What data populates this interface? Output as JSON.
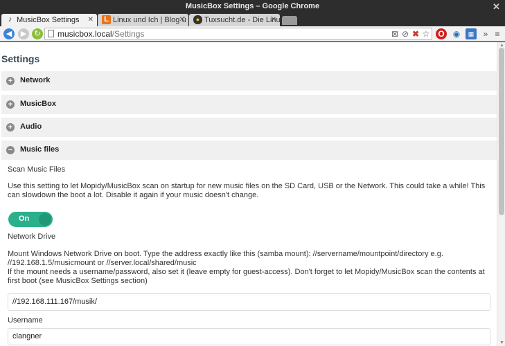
{
  "window": {
    "title": "MusicBox Settings – Google Chrome"
  },
  "tabs": [
    {
      "label": "MusicBox Settings",
      "favicon": "music-note-icon"
    },
    {
      "label": "Linux und Ich | Blog ü",
      "favicon": "letter-l-icon"
    },
    {
      "label": "Tuxsucht.de - Die Linu",
      "favicon": "tux-icon"
    }
  ],
  "toolbar": {
    "url_host": "musicbox.local",
    "url_path": "/Settings"
  },
  "page": {
    "title": "Settings",
    "sections": [
      {
        "label": "Network",
        "state": "collapsed",
        "icon": "plus-circle-icon"
      },
      {
        "label": "MusicBox",
        "state": "collapsed",
        "icon": "plus-circle-icon"
      },
      {
        "label": "Audio",
        "state": "collapsed",
        "icon": "plus-circle-icon"
      },
      {
        "label": "Music files",
        "state": "expanded",
        "icon": "minus-circle-icon"
      }
    ],
    "music_files": {
      "scan_label": "Scan Music Files",
      "scan_help": "Use this setting to let Mopidy/MusicBox scan on startup for new music files on the SD Card, USB or the Network. This could take a while! This can slowdown the boot a lot. Disable it again if your music doesn't change.",
      "scan_toggle": "On",
      "network_label": "Network Drive",
      "network_help_1": "Mount Windows Network Drive on boot. Type the address exactly like this (samba mount): //servername/mountpoint/directory e.g. //192.168.1.5/musicmount or //server.local/shared/music",
      "network_help_2": "If the mount needs a username/password, also set it (leave empty for guest-access). Don't forget to let Mopidy/MusicBox scan the contents at first boot (see MusicBox Settings section)",
      "network_value": "//192.168.111.167/musik/",
      "username_label": "Username",
      "username_value": "clangner"
    }
  },
  "colors": {
    "accent": "#2bb08c",
    "section_bg": "#f0f0f0",
    "title": "#3a4a58"
  }
}
